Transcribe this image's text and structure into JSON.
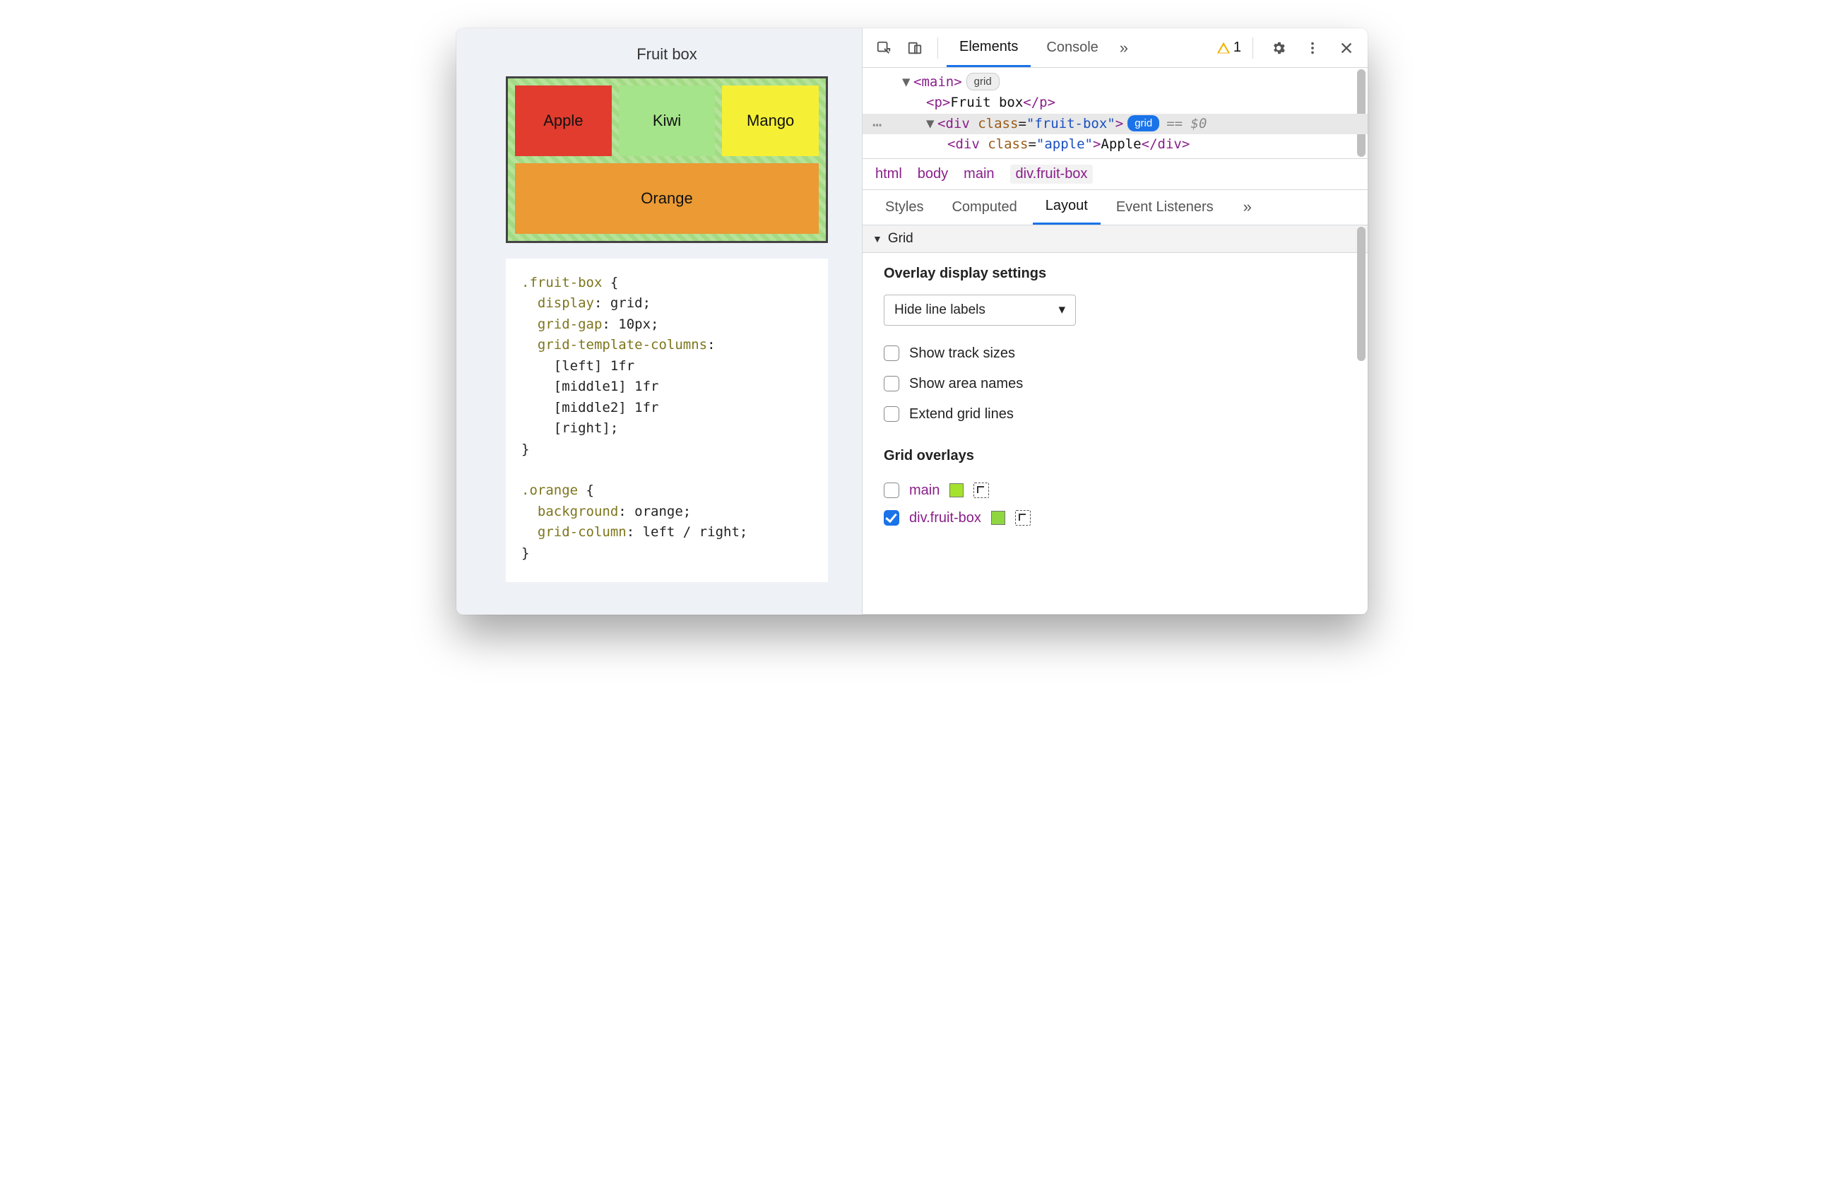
{
  "page": {
    "title": "Fruit box",
    "fruits": {
      "apple": "Apple",
      "kiwi": "Kiwi",
      "mango": "Mango",
      "orange": "Orange"
    },
    "css_code": ".fruit-box {\n  display: grid;\n  grid-gap: 10px;\n  grid-template-columns:\n    [left] 1fr\n    [middle1] 1fr\n    [middle2] 1fr\n    [right];\n}\n\n.orange {\n  background: orange;\n  grid-column: left / right;\n}"
  },
  "devtools": {
    "tabs": {
      "elements": "Elements",
      "console": "Console"
    },
    "warning_count": "1",
    "dom": {
      "main_tag": "main",
      "main_badge": "grid",
      "p_open": "<p>",
      "p_text": "Fruit box",
      "p_close": "</p>",
      "div_tag": "div",
      "div_class_attr": "class",
      "div_class_val": "\"fruit-box\"",
      "div_badge": "grid",
      "post": "== $0",
      "child_tag": "div",
      "child_class_attr": "class",
      "child_class_val": "\"apple\"",
      "child_text": "Apple",
      "child_close": "</div>"
    },
    "breadcrumb": [
      "html",
      "body",
      "main",
      "div.fruit-box"
    ],
    "subtabs": {
      "styles": "Styles",
      "computed": "Computed",
      "layout": "Layout",
      "event": "Event Listeners"
    },
    "grid_section": {
      "title": "Grid",
      "overlay_head": "Overlay display settings",
      "select_value": "Hide line labels",
      "opts": {
        "track": "Show track sizes",
        "area": "Show area names",
        "extend": "Extend grid lines"
      },
      "overlays_head": "Grid overlays",
      "overlays": [
        {
          "name": "main",
          "checked": false,
          "swatch": "#a5e22e"
        },
        {
          "name": "div.fruit-box",
          "checked": true,
          "swatch": "#8fd640"
        }
      ]
    }
  }
}
